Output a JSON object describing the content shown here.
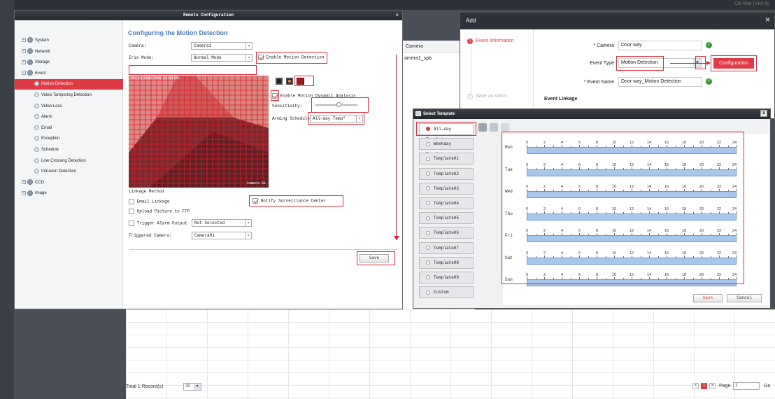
{
  "remote_config": {
    "title": "Remote Configuration",
    "close": "×",
    "tree": [
      {
        "label": "System",
        "level": 0
      },
      {
        "label": "Network",
        "level": 0
      },
      {
        "label": "Storage",
        "level": 0
      },
      {
        "label": "Event",
        "level": 0
      },
      {
        "label": "Motion Detection",
        "level": 1,
        "active": true
      },
      {
        "label": "Video Tampering Detection",
        "level": 1
      },
      {
        "label": "Video Loss",
        "level": 1
      },
      {
        "label": "Alarm",
        "level": 1
      },
      {
        "label": "Email",
        "level": 1
      },
      {
        "label": "Exception",
        "level": 1
      },
      {
        "label": "Schedule",
        "level": 1
      },
      {
        "label": "Line Crossing Detection",
        "level": 1
      },
      {
        "label": "Intrusion Detection",
        "level": 1
      },
      {
        "label": "CCD",
        "level": 0
      },
      {
        "label": "Image",
        "level": 0
      }
    ],
    "heading": "Configuring the Motion Detection",
    "camera_label": "Camera:",
    "camera_value": "Camera1",
    "iris_label": "Iris Mode:",
    "iris_value": "Normal Mode",
    "enable_motion": "Enable Motion Detection",
    "enable_dynamic": "Enable Motion Dynamic Analysis",
    "sensitivity_label": "Sensitivity:",
    "sensitivity_level": 0.55,
    "arming_label": "Arming Schedule",
    "arming_value": "All-day Temp\"",
    "video_timestamp": "05-14-2018 Mon 14:44:51",
    "video_caption": "Camera 01",
    "linkage_heading": "Linkage Method",
    "email_linkage": "Email Linkage",
    "notify_center": "Notify Surveillance Center",
    "upload_ftp": "Upload Picture to FTP",
    "trigger_alarm": "Trigger Alarm Output",
    "trigger_value": "Not Selected",
    "triggered_camera_label": "Triggered Camera:",
    "triggered_camera_value": "Camera01",
    "save": "Save"
  },
  "background": {
    "camera_header": "Camera",
    "camera_row": "amera1_spb",
    "total_records": "Total 1 Record(s)",
    "page_size": "20",
    "page_label": "Page",
    "page_value": "1",
    "current_page": "1",
    "go": "Go",
    "user_area": "Cle Mar  |  Hol dy"
  },
  "add_panel": {
    "title": "Add",
    "close": "×",
    "steps": [
      "Event Information",
      "Save as Alarm"
    ],
    "step_numbers": [
      "1",
      "2"
    ],
    "camera_label": "* Camera",
    "camera_value": "Door way",
    "event_type_label": "Event Type",
    "event_type_value": "Motion Detection",
    "configuration_btn": "Configuration",
    "event_name_label": "* Event Name",
    "event_name_value": "Door way_Motion Detection",
    "event_linkage": "Event Linkage"
  },
  "select_template": {
    "title": "Select Template",
    "close": "x",
    "templates": [
      "All-day Template",
      "Weekday Template",
      "Template01",
      "Template02",
      "Template03",
      "Template04",
      "Template05",
      "Template06",
      "Template07",
      "Template08",
      "Template09",
      "Custom"
    ],
    "selected_index": 0,
    "days": [
      "Mon",
      "Tue",
      "Wed",
      "Thu",
      "Fri",
      "Sat",
      "Sun"
    ],
    "hours": [
      "0",
      "2",
      "4",
      "6",
      "8",
      "10",
      "12",
      "14",
      "16",
      "18",
      "20",
      "22",
      "24"
    ],
    "save": "Save",
    "cancel": "Cancel"
  }
}
